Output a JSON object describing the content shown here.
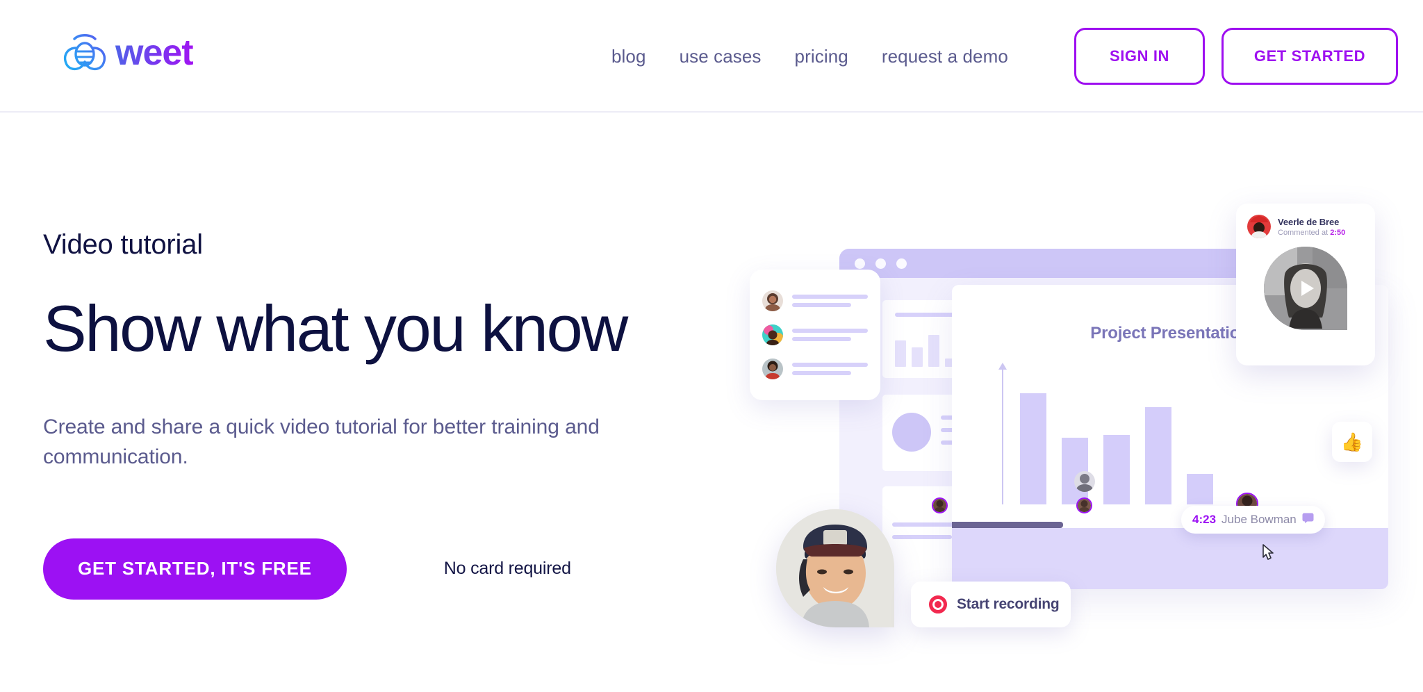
{
  "brand": {
    "name": "weet",
    "logo_icon": "bee-logo-icon",
    "gradient_start": "#4f63e8",
    "gradient_end": "#a312f2"
  },
  "header": {
    "nav": [
      {
        "label": "blog",
        "name": "nav-link-blog"
      },
      {
        "label": "use cases",
        "name": "nav-link-use-cases"
      },
      {
        "label": "pricing",
        "name": "nav-link-pricing"
      },
      {
        "label": "request a demo",
        "name": "nav-link-request-a-demo"
      }
    ],
    "sign_in_label": "SIGN IN",
    "get_started_label": "GET STARTED",
    "accent": "#9e0ff0"
  },
  "hero": {
    "eyebrow": "Video tutorial",
    "headline": "Show what you know",
    "subhead": "Create and share a quick video tutorial for better training and communication.",
    "cta_label": "GET STARTED, IT'S FREE",
    "cta_color": "#9c11f3",
    "note": "No card required",
    "headline_color": "#0d1140",
    "body_color": "#5b5b8e"
  },
  "illustration": {
    "presentation_title": "Project Presentation",
    "record_button_label": "Start recording",
    "record_icon": "record-dot-icon",
    "record_color": "#f2294f",
    "reaction_emoji": "👍",
    "tooltip": {
      "time": "4:23",
      "name": "Jube Bowman",
      "icon": "comment-bubble-icon",
      "time_color": "#9c11f3"
    },
    "comment_card": {
      "author": "Veerle de Bree",
      "meta_prefix": "Commented at ",
      "meta_time": "2:50",
      "play_icon": "play-icon",
      "time_color": "#b824e8"
    },
    "people_card": {
      "rows": 3
    },
    "chart_bars": [
      80,
      48,
      50,
      70,
      22
    ],
    "window_dots": 3
  }
}
